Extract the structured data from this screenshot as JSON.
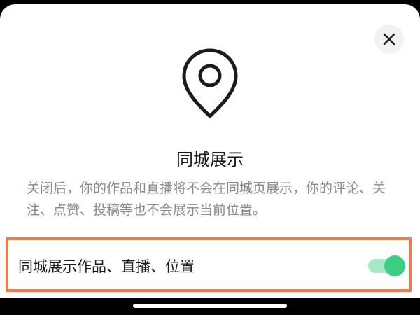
{
  "sheet": {
    "close_icon": "close-icon",
    "pin_icon": "location-pin-icon",
    "title": "同城展示",
    "description": "关闭后，你的作品和直播将不会在同城页展示，你的评论、关注、点赞、投稿等也不会展示当前位置。"
  },
  "setting": {
    "label": "同城展示作品、直播、位置",
    "toggle_on": true
  },
  "colors": {
    "highlight_border": "#ef7a4c",
    "toggle_on": "#3ccf82",
    "toggle_track": "#a8e8c4",
    "description_text": "#8a8a8a"
  }
}
